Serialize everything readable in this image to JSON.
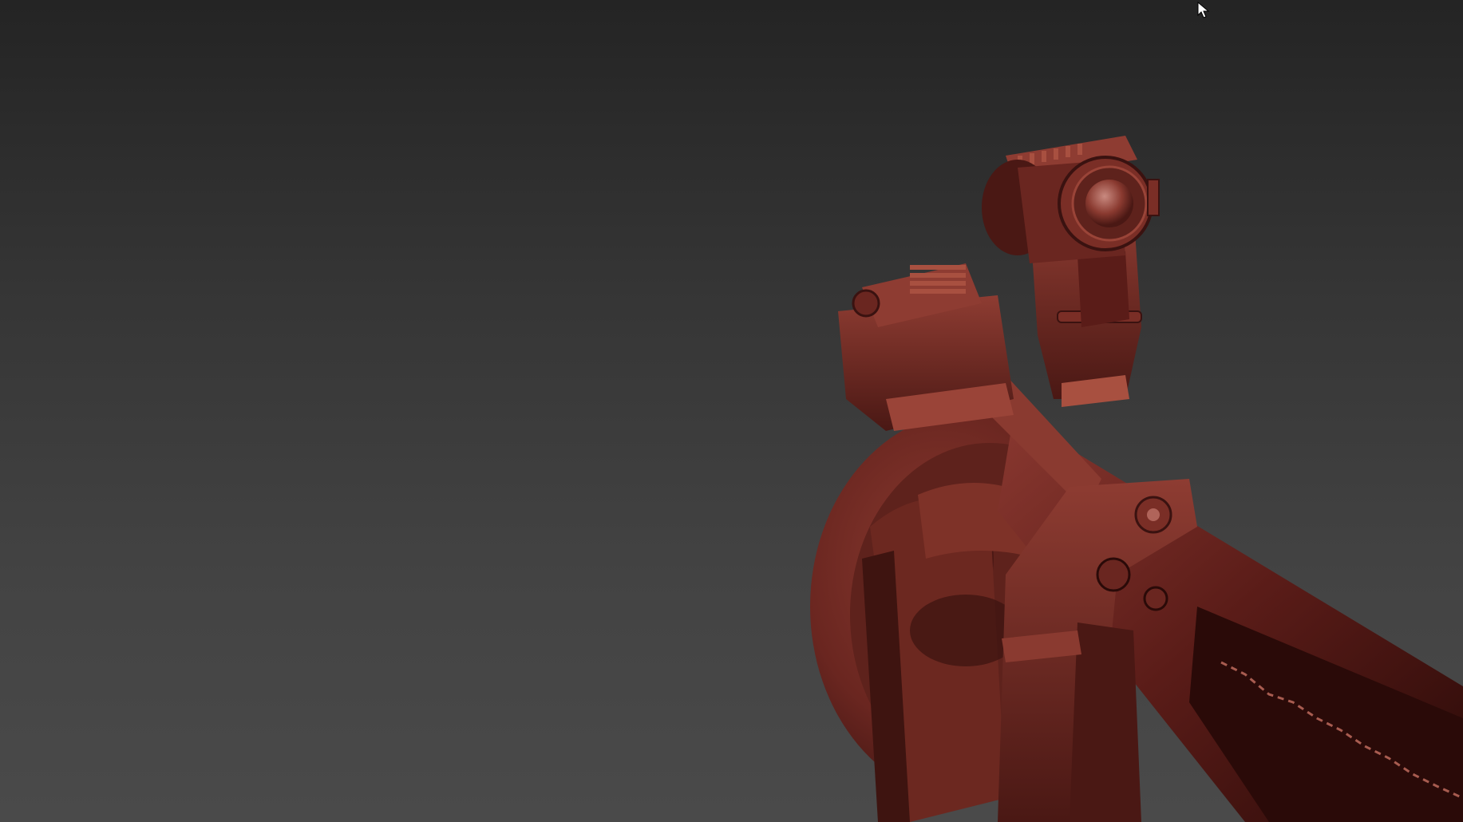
{
  "viewport": {
    "background_top": "#242424",
    "background_bottom": "#4a4a4a"
  },
  "model": {
    "material_color": "#7a2e26",
    "shadow_color": "#3a1210",
    "highlight_color": "#b0645a"
  },
  "cursor": {
    "icon": "arrow-pointer-icon"
  }
}
